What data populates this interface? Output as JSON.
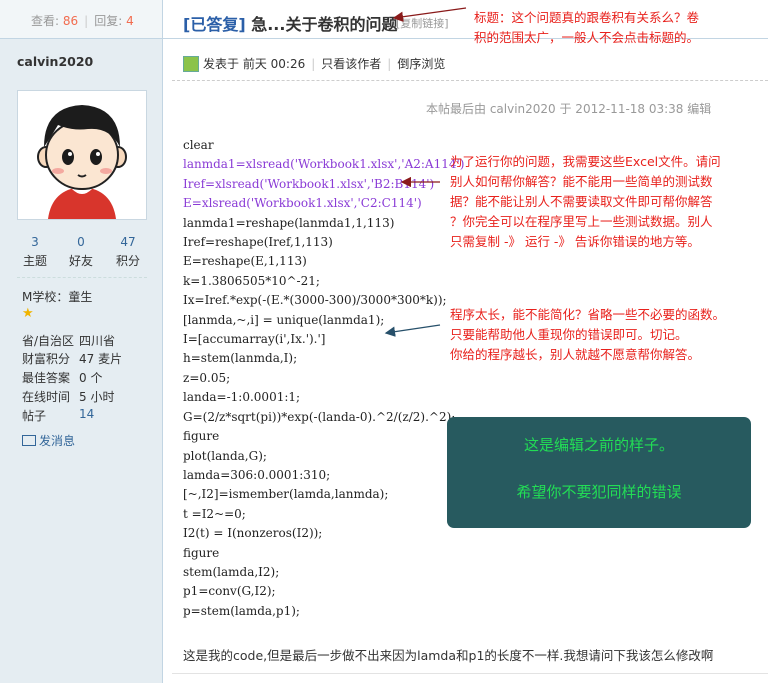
{
  "stats": {
    "views_label": "查看:",
    "views": "86",
    "replies_label": "回复:",
    "replies": "4"
  },
  "thread": {
    "tag": "[已答复]",
    "title": "急...关于卷积的问题",
    "copy_link": "[复制链接]"
  },
  "user": {
    "name": "calvin2020",
    "counters": [
      {
        "num": "3",
        "label": "主题"
      },
      {
        "num": "0",
        "label": "好友"
      },
      {
        "num": "47",
        "label": "积分"
      }
    ],
    "group": "M学校：童生",
    "info": [
      {
        "label": "省/自治区",
        "value": "四川省",
        "link": false
      },
      {
        "label": "财富积分",
        "value": "47 麦片",
        "link": false
      },
      {
        "label": "最佳答案",
        "value": "0 个",
        "link": false
      },
      {
        "label": "在线时间",
        "value": "5 小时",
        "link": false
      },
      {
        "label": "帖子",
        "value": "14",
        "link": true
      }
    ],
    "message": "发消息"
  },
  "post": {
    "posted": "发表于 前天 00:26",
    "only_author": "只看该作者",
    "reverse": "倒序浏览",
    "edited": "本帖最后由 calvin2020 于 2012-11-18 03:38 编辑",
    "code_lines": [
      {
        "text": "clear",
        "purple": false
      },
      {
        "text": "lanmda1=xlsread('Workbook1.xlsx','A2:A114')",
        "purple": true
      },
      {
        "text": "Iref=xlsread('Workbook1.xlsx','B2:B114')",
        "purple": true
      },
      {
        "text": "E=xlsread('Workbook1.xlsx','C2:C114')",
        "purple": true
      },
      {
        "text": "lanmda1=reshape(lanmda1,1,113)",
        "purple": false
      },
      {
        "text": "Iref=reshape(Iref,1,113)",
        "purple": false
      },
      {
        "text": "E=reshape(E,1,113)",
        "purple": false
      },
      {
        "text": "k=1.3806505*10^-21;",
        "purple": false
      },
      {
        "text": "Ix=Iref.*exp(-(E.*(3000-300)/3000*300*k));",
        "purple": false
      },
      {
        "text": "[lanmda,~,i] = unique(lanmda1);",
        "purple": false
      },
      {
        "text": "I=[accumarray(i',Ix.').']",
        "purple": false
      },
      {
        "text": "h=stem(lanmda,I);",
        "purple": false
      },
      {
        "text": "z=0.05;",
        "purple": false
      },
      {
        "text": "landa=-1:0.0001:1;",
        "purple": false
      },
      {
        "text": "G=(2/z*sqrt(pi))*exp(-(landa-0).^2/(z/2).^2);",
        "purple": false
      },
      {
        "text": "figure",
        "purple": false
      },
      {
        "text": "plot(landa,G);",
        "purple": false
      },
      {
        "text": "lamda=306:0.0001:310;",
        "purple": false
      },
      {
        "text": "[~,I2]=ismember(lamda,lanmda);",
        "purple": false
      },
      {
        "text": "t =I2~=0;",
        "purple": false
      },
      {
        "text": "I2(t) = I(nonzeros(I2));",
        "purple": false
      },
      {
        "text": "figure",
        "purple": false
      },
      {
        "text": "stem(lamda,I2);",
        "purple": false
      },
      {
        "text": "p1=conv(G,I2);",
        "purple": false
      },
      {
        "text": "p=stem(lamda,p1);",
        "purple": false
      }
    ],
    "description": "这是我的code,但是最后一步做不出来因为lamda和p1的长度不一样.我想请问下我该怎么修改啊"
  },
  "annotations": {
    "title_note": [
      "标题：这个问题真的跟卷积有关系么？卷",
      "积的范围太广，一般人不会点击标题的。"
    ],
    "excel_note": [
      "为了运行你的问题，我需要这些Excel文件。请问",
      "别人如何帮你解答？能不能用一些简单的测试数",
      "据？能不能让别人不需要读取文件即可帮你解答",
      "？你完全可以在程序里写上一些测试数据。别人",
      "只需复制 -》  运行 -》  告诉你错误的地方等。"
    ],
    "length_note": [
      "程序太长，能不能简化？省略一些不必要的函数。",
      "只要能帮助他人重现你的错误即可。切记。",
      "你给的程序越长，别人就越不愿意帮你解答。"
    ],
    "callout_line1": "这是编辑之前的样子。",
    "callout_line2": "希望你不要犯同样的错误"
  },
  "colors": {
    "annotation": "#e8211c",
    "callout_bg": "#275a5f",
    "callout_text": "#22dd55",
    "code_purple": "#8a3bd6",
    "link": "#336699"
  }
}
